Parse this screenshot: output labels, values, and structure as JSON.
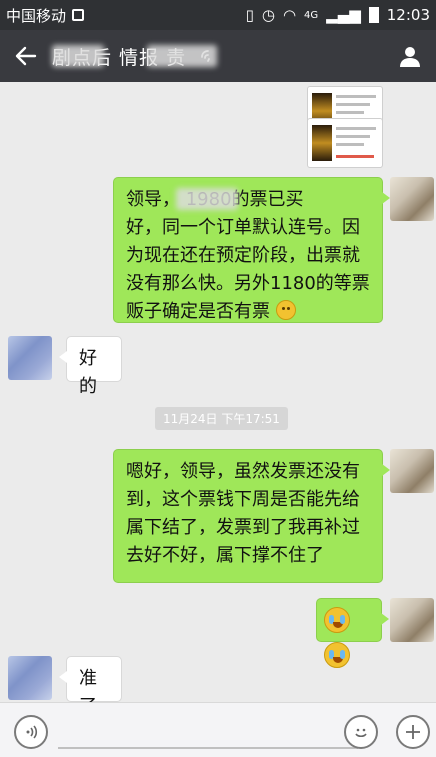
{
  "status_bar": {
    "carrier": "中国移动",
    "time": "12:03",
    "network": "4G"
  },
  "header": {
    "back_icon": "arrow-left-icon",
    "title": "剧院酒店信息情报科长",
    "title_visible": "剧点后 情报   责",
    "speaker_icon": "earpiece-icon",
    "profile_icon": "person-icon"
  },
  "messages": {
    "m1": "领导，    1980的票已买好，同一个订单默认连号。因为现在还在预定阶段，出票就没有那么快。另外1180的等票贩子确定是否有票",
    "m1_lines": [
      "领导，      1980的票已买",
      "好，同一个订单默认连号。因",
      "为现在还在预定阶段，出票就",
      "没有那么快。另外1180的等票",
      "贩子确定是否有票"
    ],
    "m2": "好的",
    "timestamp": "11月24日 下午17:51",
    "m3_lines": [
      "嗯好，领导，虽然发票还没有",
      "到，这个票钱下周是否能先给",
      "属下结了，发票到了我再补过",
      "去好不好，属下撑不住了"
    ],
    "m4_emoji": "crying-face-emoji x2",
    "m5": "准了"
  },
  "input_bar": {
    "voice_icon": "voice-icon",
    "emoji_icon": "smile-icon",
    "plus_icon": "plus-icon"
  }
}
